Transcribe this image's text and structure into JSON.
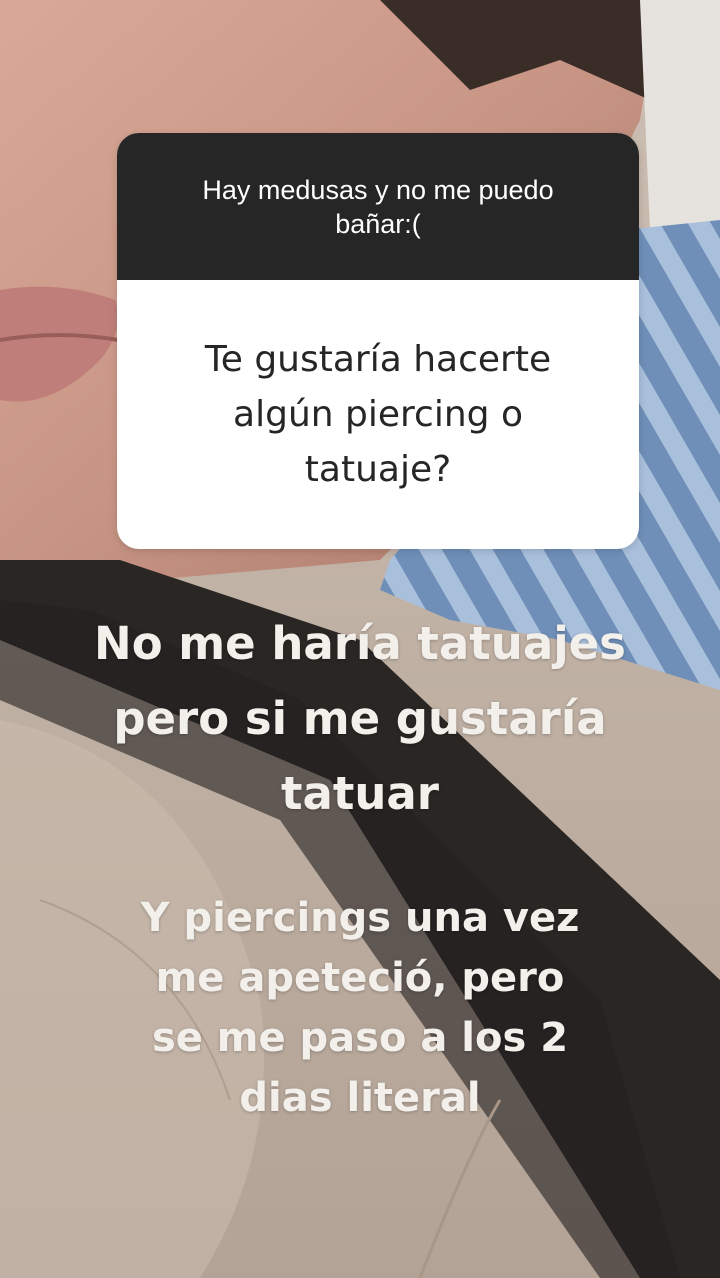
{
  "question_sticker": {
    "prompt": "Hay medusas y no me puedo bañar:(",
    "question": "Te gustaría hacerte algún piercing o tatuaje?"
  },
  "answer_text": {
    "line1": "No me haría tatuajes pero si me gustaría tatuar",
    "line2": "Y piercings una vez me apeteció, pero se me paso a los 2 dias literal"
  },
  "colors": {
    "sticker_header": "#262626",
    "sticker_body": "#ffffff",
    "answer_text": "#f3f0ec"
  }
}
